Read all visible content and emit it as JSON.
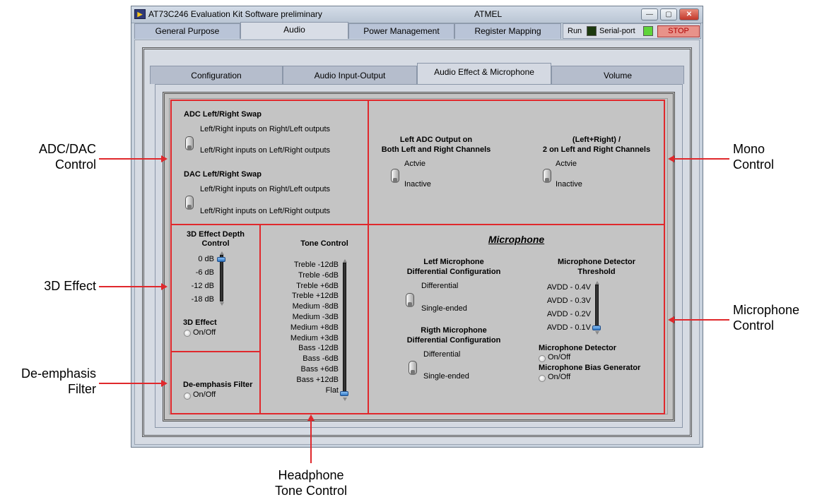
{
  "window": {
    "icon": "labview-icon",
    "title_left": "AT73C246   Evaluation Kit Software preliminary",
    "title_center": "ATMEL",
    "minimize": "—",
    "maximize": "▢",
    "close": "✕"
  },
  "top_tabs": [
    "General Purpose",
    "Audio",
    "Power Management",
    "Register Mapping"
  ],
  "top_tabs_active": "Audio",
  "status": {
    "run_label": "Run",
    "serial_label": "Serial-port",
    "stop_label": "STOP",
    "run_led_color": "#1d3a10",
    "serial_led_color": "#5fd43a"
  },
  "sub_tabs": [
    "Configuration",
    "Audio Input-Output",
    "Audio Effect & Microphone",
    "Volume"
  ],
  "sub_tabs_active": "Audio Effect & Microphone",
  "adc_dac": {
    "adc_title": "ADC Left/Right Swap",
    "adc_opt1": "Left/Right inputs on Right/Left outputs",
    "adc_opt2": "Left/Right inputs on Left/Right outputs",
    "dac_title": "DAC Left/Right Swap",
    "dac_opt1": "Left/Right inputs on Right/Left outputs",
    "dac_opt2": "Left/Right inputs on Left/Right outputs"
  },
  "mono": {
    "left_title_1": "Left ADC Output on",
    "left_title_2": "Both Left and Right Channels",
    "left_on": "Actvie",
    "left_off": "Inactive",
    "right_title_1": "(Left+Right) /",
    "right_title_2": "2 on Left and Right Channels",
    "right_on": "Actvie",
    "right_off": "Inactive"
  },
  "effect3d": {
    "title_1": "3D Effect Depth",
    "title_2": "Control",
    "ticks": [
      "0 dB",
      "-6 dB",
      "-12 dB",
      "-18 dB"
    ],
    "value": "0 dB",
    "toggle_title": "3D Effect",
    "toggle_label": "On/Off"
  },
  "deemphasis": {
    "title": "De-emphasis Filter",
    "toggle_label": "On/Off"
  },
  "tone": {
    "title": "Tone Control",
    "ticks": [
      "Treble  -12dB",
      "Treble    -6dB",
      "Treble   +6dB",
      "Treble +12dB",
      "Medium    -8dB",
      "Medium    -3dB",
      "Medium   +8dB",
      "Medium   +3dB",
      "Bass  -12dB",
      "Bass    -6dB",
      "Bass   +6dB",
      "Bass +12dB",
      "Flat"
    ],
    "value": "Flat"
  },
  "microphone": {
    "title": "Microphone",
    "left_title_1": "Letf Microphone",
    "left_title_2": "Differential Configuration",
    "left_on": "Differential",
    "left_off": "Single-ended",
    "right_title_1": "Rigth Microphone",
    "right_title_2": "Differential Configuration",
    "right_on": "Differential",
    "right_off": "Single-ended",
    "threshold_title_1": "Microphone Detector",
    "threshold_title_2": "Threshold",
    "threshold_ticks": [
      "AVDD - 0.4V",
      "AVDD - 0.3V",
      "AVDD - 0.2V",
      "AVDD - 0.1V"
    ],
    "threshold_value": "AVDD - 0.1V",
    "detector_title": "Microphone Detector",
    "detector_label": "On/Off",
    "bias_title": "Microphone Bias Generator",
    "bias_label": "On/Off"
  },
  "annotations": {
    "adc_dac_1": "ADC/DAC",
    "adc_dac_2": "Control",
    "effect3d": "3D Effect",
    "deemph_1": "De-emphasis",
    "deemph_2": "Filter",
    "mono_1": "Mono",
    "mono_2": "Control",
    "mic_1": "Microphone",
    "mic_2": "Control",
    "tone_1": "Headphone",
    "tone_2": "Tone Control"
  }
}
